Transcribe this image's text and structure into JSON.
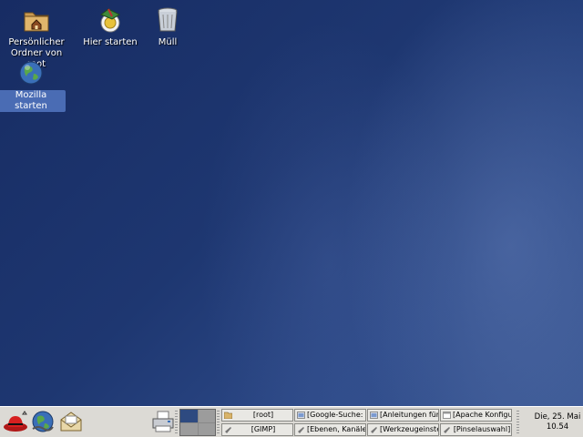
{
  "desktop": {
    "icons": [
      {
        "label": "Persönlicher Ordner von root",
        "icon": "home-folder-icon"
      },
      {
        "label": "Hier starten",
        "icon": "start-here-icon"
      },
      {
        "label": "Müll",
        "icon": "trash-icon"
      },
      {
        "label": "Mozilla starten",
        "icon": "mozilla-globe-icon",
        "selected": true
      }
    ]
  },
  "panel": {
    "launchers": [
      {
        "name": "redhat-menu-icon"
      },
      {
        "name": "mozilla-launcher-icon"
      },
      {
        "name": "mail-launcher-icon"
      },
      {
        "name": "printer-launcher-icon"
      }
    ],
    "workspaces": {
      "count": 4,
      "active": 0
    },
    "tasks": [
      {
        "label": "[root]",
        "icon": "folder-icon"
      },
      {
        "label": "[GIMP]",
        "icon": "gimp-icon"
      },
      {
        "label": "[Google-Suche: sc",
        "icon": "browser-icon"
      },
      {
        "label": "[Ebenen, Kanäle u",
        "icon": "gimp-icon"
      },
      {
        "label": "[Anleitungen für Li",
        "icon": "browser-icon"
      },
      {
        "label": "[Werkzeugeinstellu",
        "icon": "gimp-icon"
      },
      {
        "label": "[Apache Konfigura",
        "icon": "window-icon"
      },
      {
        "label": "[Pinselauswahl]",
        "icon": "gimp-icon"
      }
    ],
    "clock": {
      "date": "Die, 25. Mai",
      "time": "10.54"
    }
  }
}
